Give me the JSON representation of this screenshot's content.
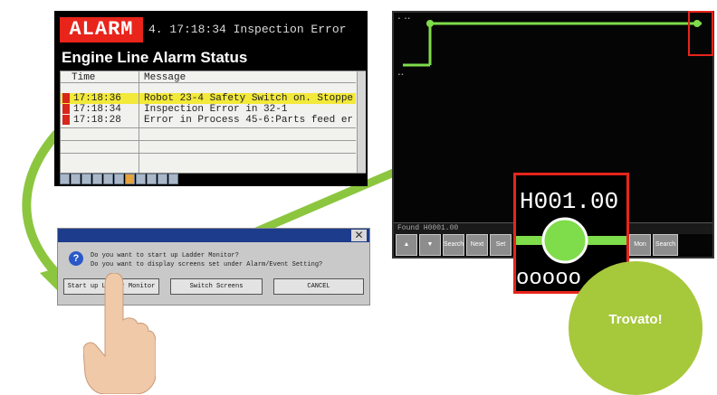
{
  "alarm_panel": {
    "badge": "ALARM",
    "ticker": "4.    17:18:34 Inspection Error",
    "title": "Engine Line Alarm Status",
    "columns": [
      "Time",
      "Message"
    ],
    "rows": [
      {
        "time": "17:18:36",
        "message": "Robot 23-4 Safety Switch on. Stoppe",
        "highlighted": true
      },
      {
        "time": "17:18:34",
        "message": "Inspection Error in 32-1",
        "highlighted": false
      },
      {
        "time": "17:18:28",
        "message": "Error in Process 45-6:Parts feed er",
        "highlighted": false
      }
    ]
  },
  "dialog": {
    "message_1": "Do you want to start up Ladder Monitor?",
    "message_2": "Do you want to display screens set under Alarm/Event Setting?",
    "buttons": [
      "Start up Ladder Monitor",
      "Switch Screens",
      "CANCEL"
    ]
  },
  "ladder_panel": {
    "status": "Found H0001.00",
    "buttons": [
      "Search",
      "Next",
      "Set",
      "Mon",
      "Search Prev"
    ],
    "zoom_label": "H001.00"
  },
  "badge": {
    "label": "Trovato!"
  },
  "colors": {
    "alarm_red": "#e8241b",
    "highlight_yellow": "#f3e93a",
    "accent_green": "#a6c83b",
    "ladder_green": "#7fdc4a"
  }
}
